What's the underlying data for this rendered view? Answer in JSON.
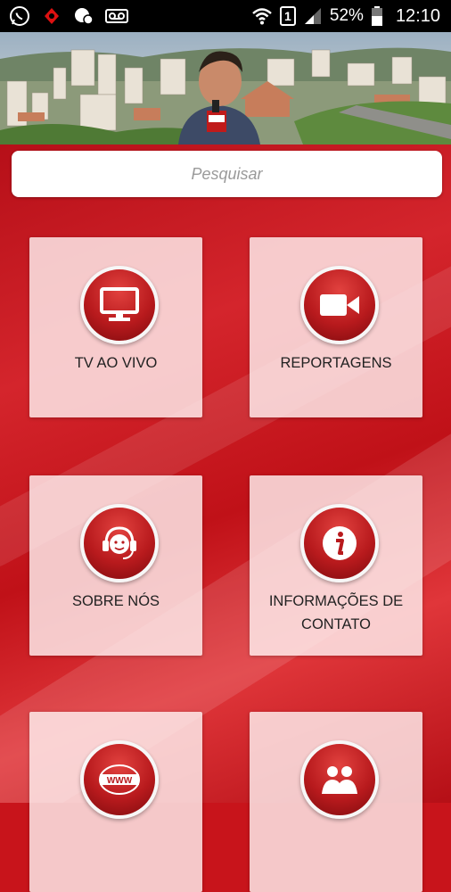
{
  "status_bar": {
    "battery": "52%",
    "time": "12:10",
    "sim_badge": "1",
    "icons": [
      "whatsapp-icon",
      "app-icon",
      "chat-icon",
      "voicemail-icon",
      "wifi-icon",
      "signal-icon",
      "battery-icon"
    ]
  },
  "search": {
    "placeholder": "Pesquisar"
  },
  "menu": {
    "items": [
      {
        "label": "TV AO VIVO",
        "icon": "monitor-icon"
      },
      {
        "label": "REPORTAGENS",
        "icon": "video-camera-icon"
      },
      {
        "label": "SOBRE NÓS",
        "icon": "headset-icon"
      },
      {
        "label": "INFORMAÇÕES DE CONTATO",
        "icon": "info-icon"
      },
      {
        "label": "",
        "icon": "www-icon"
      },
      {
        "label": "",
        "icon": "people-icon"
      }
    ]
  },
  "colors": {
    "primary_red": "#c8141b",
    "card_bg": "#fcecec",
    "icon_red": "#b81a1d"
  }
}
